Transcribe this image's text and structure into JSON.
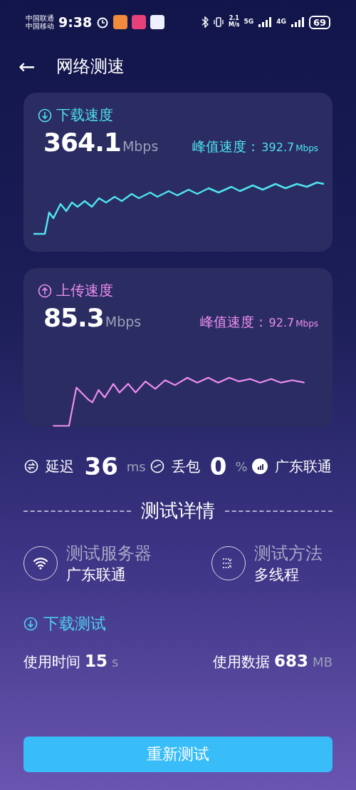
{
  "status_bar": {
    "carriers": [
      "中国联通",
      "中国移动"
    ],
    "time": "9:38",
    "net_speed": [
      "2.1",
      "M/s"
    ],
    "networks": [
      "5G",
      "4G"
    ],
    "battery": "69"
  },
  "header": {
    "back": "←",
    "title": "网络测速"
  },
  "speed_cards": [
    {
      "kind": "download",
      "title": "下载速度",
      "value": "364.1",
      "unit": "Mbps",
      "peak_label": "峰值速度：",
      "peak_value": "392.7",
      "peak_unit": "Mbps",
      "color": "#4fe3ee"
    },
    {
      "kind": "upload",
      "title": "上传速度",
      "value": "85.3",
      "unit": "Mbps",
      "peak_label": "峰值速度：",
      "peak_value": "92.7",
      "peak_unit": "Mbps",
      "color": "#ee8ff0"
    }
  ],
  "stats": [
    {
      "kind": "latency",
      "label": "延迟",
      "value": "36",
      "unit": "ms"
    },
    {
      "kind": "loss",
      "label": "丢包",
      "value": "0",
      "unit": "%"
    },
    {
      "kind": "isp",
      "label": "广东联通"
    }
  ],
  "details": {
    "title": "测试详情",
    "items": [
      {
        "kind": "server",
        "label": "测试服务器",
        "value": "广东联通"
      },
      {
        "kind": "method",
        "label": "测试方法",
        "value": "多线程"
      }
    ]
  },
  "download_test": {
    "title": "下载测试",
    "time_label": "使用时间",
    "time_value": "15",
    "time_unit": "s",
    "data_label": "使用数据",
    "data_value": "683",
    "data_unit": "MB"
  },
  "retest_button": "重新测试"
}
